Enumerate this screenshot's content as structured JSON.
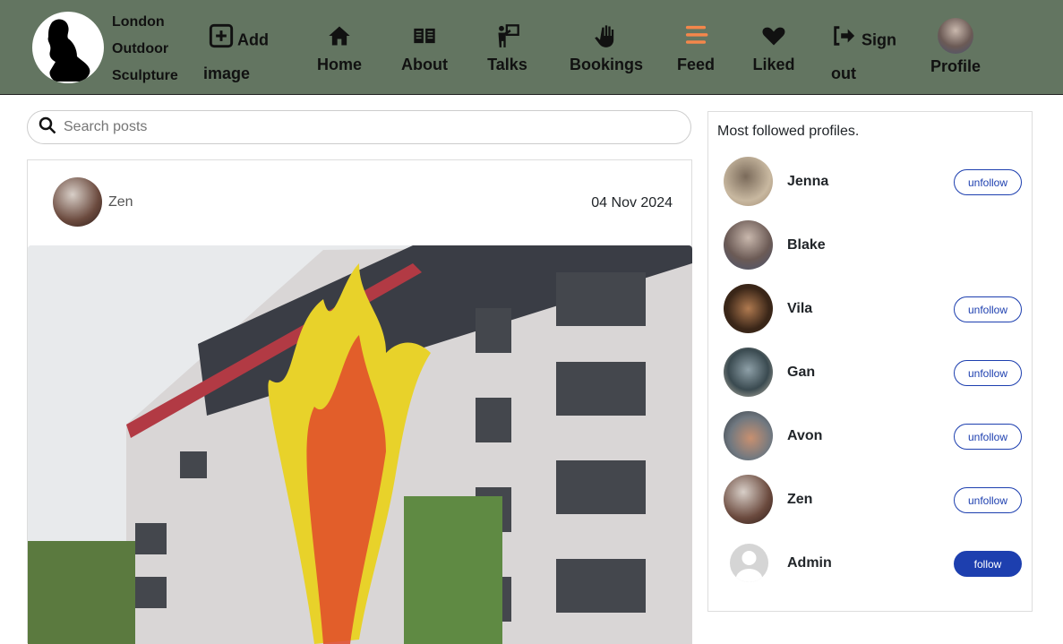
{
  "nav": {
    "brand": [
      "London",
      "Outdoor",
      "Sculpture"
    ],
    "add_image": [
      "Add",
      "image"
    ],
    "home": "Home",
    "about": "About",
    "talks": "Talks",
    "bookings": "Bookings",
    "feed": "Feed",
    "liked": "Liked",
    "sign_out": [
      "Sign",
      "out"
    ],
    "profile": "Profile",
    "active": "Feed",
    "accent": "#f4874b"
  },
  "search": {
    "placeholder": "Search posts"
  },
  "post": {
    "author": "Zen",
    "date": "04 Nov 2024"
  },
  "sidebar": {
    "title": "Most followed profiles.",
    "profiles": [
      {
        "name": "Jenna",
        "button": "unfollow"
      },
      {
        "name": "Blake",
        "button": ""
      },
      {
        "name": "Vila",
        "button": "unfollow"
      },
      {
        "name": "Gan",
        "button": "unfollow"
      },
      {
        "name": "Avon",
        "button": "unfollow"
      },
      {
        "name": "Zen",
        "button": "unfollow"
      },
      {
        "name": "Admin",
        "button": "follow"
      }
    ]
  }
}
